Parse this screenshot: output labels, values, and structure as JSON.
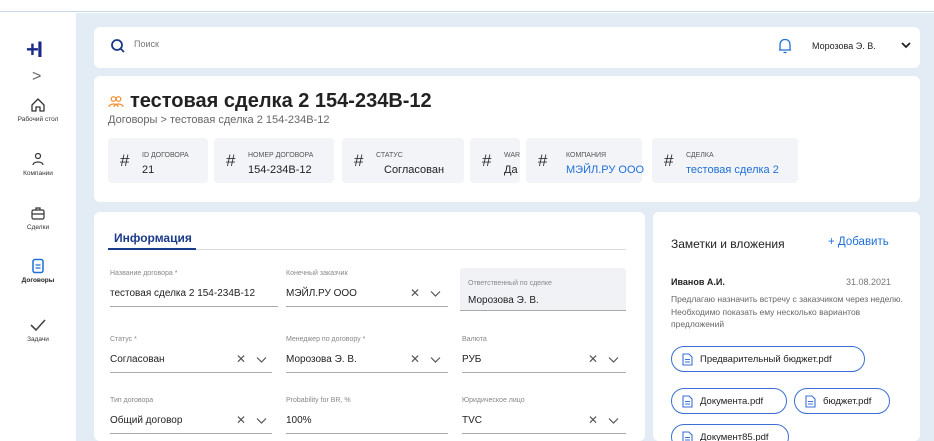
{
  "sidebar": {
    "items": [
      {
        "label": "Рабочий стол",
        "icon": "home-icon"
      },
      {
        "label": "Компании",
        "icon": "company-icon"
      },
      {
        "label": "Сделки",
        "icon": "briefcase-icon"
      },
      {
        "label": "Договоры",
        "icon": "document-icon",
        "active": true
      },
      {
        "label": "Задачи",
        "icon": "check-icon"
      }
    ]
  },
  "header": {
    "logo": "+I",
    "expand": ">",
    "search_placeholder": "Поиск",
    "user_name": "Морозова Э. В."
  },
  "page": {
    "title": "тестовая сделка 2 154-234В-12",
    "breadcrumb": "Договоры  >  тестовая сделка 2 154-234В-12"
  },
  "stats": [
    {
      "label": "ID ДОГОВОРА",
      "value": "21"
    },
    {
      "label": "НОМЕР ДОГОВОРА",
      "value": "154-234В-12"
    },
    {
      "label": "СТАТУС",
      "value": "Согласован"
    },
    {
      "label": "WAR",
      "value": "Да"
    },
    {
      "label": "КОМПАНИЯ",
      "value": "МЭЙЛ.РУ ООО"
    },
    {
      "label": "СДЕЛКА",
      "value": "тестовая сделка 2"
    }
  ],
  "info": {
    "tab": "Информация",
    "fields": [
      {
        "label": "Название договора *",
        "value": "тестовая сделка 2 154-234В-12"
      },
      {
        "label": "Конечный заказчик",
        "value": "МЭЙЛ.РУ ООО"
      },
      {
        "label": "Ответственный по сделке",
        "value": "Морозова Э. В."
      },
      {
        "label": "Статус *",
        "value": "Согласован"
      },
      {
        "label": "Менеджер по договору *",
        "value": "Морозова Э. В."
      },
      {
        "label": "Валюта",
        "value": "РУБ"
      },
      {
        "label": "Тип договора",
        "value": "Общий договор"
      },
      {
        "label": "Probability for BR, %",
        "value": "100%"
      },
      {
        "label": "Юридическое лицо",
        "value": "TVC"
      }
    ]
  },
  "notes": {
    "title": "Заметки и вложения",
    "add_label": "+  Добавить",
    "author": "Иванов А.И.",
    "date": "31.08.2021",
    "text": "Предлагаю назначить встречу с заказчиком через неделю. Необходимо показать ему несколько вариантов предложений",
    "files": [
      "Предварительный бюджет.pdf",
      "Документа.pdf",
      "бюджет.pdf",
      "Документ85.pdf"
    ]
  },
  "colors": {
    "accent": "#1e6fd9",
    "brand": "#1a2a8a",
    "deal_icon": "#f28c28",
    "background": "#e3ebf4"
  }
}
